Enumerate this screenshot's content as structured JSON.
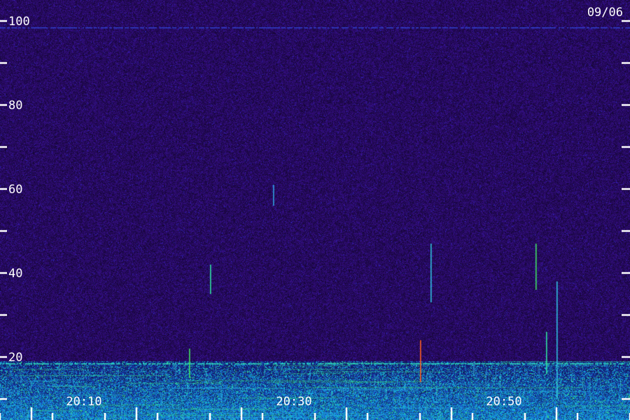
{
  "chart_data": {
    "type": "heatmap",
    "title": "",
    "xlabel": "",
    "ylabel": "",
    "date_label": "09/06",
    "ylim": [
      0,
      100
    ],
    "y_ticks_major": [
      20,
      40,
      60,
      80,
      100
    ],
    "y_ticks_minor": [
      10,
      30,
      50,
      70,
      90
    ],
    "y_tick_labels": [
      "20",
      "40",
      "60",
      "80",
      "100"
    ],
    "x_tick_labels": [
      "20:10",
      "20:30",
      "20:50"
    ],
    "x_range_minutes": [
      "20:02",
      "21:02"
    ],
    "x_major_ticks": [
      "20:05",
      "20:15",
      "20:25",
      "20:35",
      "20:45",
      "20:55"
    ],
    "x_minor_ticks": [
      "20:10",
      "20:20",
      "20:30",
      "20:40",
      "20:50",
      "21:00"
    ],
    "colors": {
      "background": "#2a0d5e",
      "low_band": "#1a3fb0",
      "mid": "#1ab0e0",
      "high": "#40e860",
      "peak": "#ff4020"
    },
    "bursts": [
      {
        "time": "20:22",
        "y_from": 35,
        "y_to": 42,
        "color": "#30e0a0"
      },
      {
        "time": "20:28",
        "y_from": 56,
        "y_to": 61,
        "color": "#30a0e0"
      },
      {
        "time": "20:42",
        "y_from": 14,
        "y_to": 24,
        "color": "#ff6020"
      },
      {
        "time": "20:43",
        "y_from": 33,
        "y_to": 47,
        "color": "#30c0e0"
      },
      {
        "time": "20:53",
        "y_from": 36,
        "y_to": 47,
        "color": "#40e060"
      },
      {
        "time": "20:54",
        "y_from": 16,
        "y_to": 26,
        "color": "#30e0a0"
      },
      {
        "time": "20:55",
        "y_from": 10,
        "y_to": 38,
        "color": "#30c0e0"
      },
      {
        "time": "20:20",
        "y_from": 15,
        "y_to": 22,
        "color": "#40e060"
      }
    ],
    "horizontal_lines": [
      {
        "y": 98.5,
        "color": "#3040d0"
      },
      {
        "y": 18.5,
        "color": "#30e0c0"
      },
      {
        "y": 5,
        "color": "#40e860"
      }
    ]
  }
}
